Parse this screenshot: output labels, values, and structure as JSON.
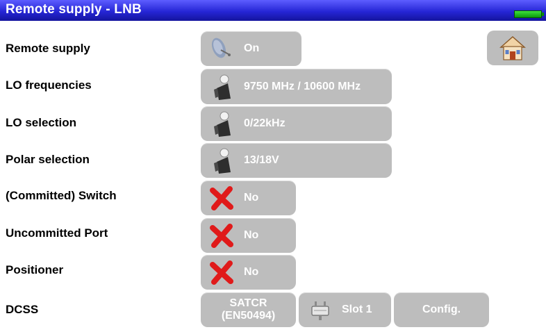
{
  "header": {
    "title": "Remote supply - LNB"
  },
  "rows": [
    {
      "label": "Remote supply",
      "value": "On",
      "icon": "satellite-dish-icon"
    },
    {
      "label": "LO frequencies",
      "value": "9750 MHz / 10600 MHz",
      "icon": "lnb-icon"
    },
    {
      "label": "LO selection",
      "value": "0/22kHz",
      "icon": "lnb-icon"
    },
    {
      "label": "Polar selection",
      "value": "13/18V",
      "icon": "lnb-icon"
    },
    {
      "label": "(Committed) Switch",
      "value": "No",
      "icon": "red-x-icon"
    },
    {
      "label": "Uncommitted Port",
      "value": "No",
      "icon": "red-x-icon"
    },
    {
      "label": "Positioner",
      "value": "No",
      "icon": "red-x-icon"
    },
    {
      "label": "DCSS",
      "value": "SATCR (EN50494)"
    }
  ],
  "dcss": {
    "slot_label": "Slot 1",
    "config_label": "Config."
  },
  "colors": {
    "titlebar": "#2626d6",
    "button": "#bdbdbd",
    "battery": "#22c322",
    "cross": "#e01a1a"
  }
}
